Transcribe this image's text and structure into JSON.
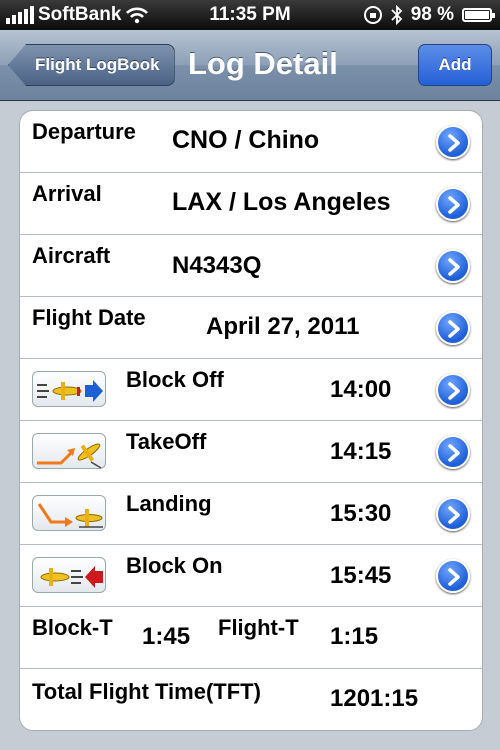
{
  "status_bar": {
    "carrier": "SoftBank",
    "time": "11:35 PM",
    "battery": "98 %",
    "battery_level": 0.98
  },
  "nav": {
    "back_label": "Flight LogBook",
    "title": "Log Detail",
    "add_label": "Add"
  },
  "rows": {
    "departure": {
      "label": "Departure",
      "value": "CNO / Chino"
    },
    "arrival": {
      "label": "Arrival",
      "value": "LAX / Los Angeles"
    },
    "aircraft": {
      "label": "Aircraft",
      "value": "N4343Q"
    },
    "flight_date": {
      "label": "Flight Date",
      "value": "April 27, 2011"
    },
    "block_off": {
      "label": "Block Off",
      "value": "14:00",
      "icon": "block-off-icon"
    },
    "takeoff": {
      "label": "TakeOff",
      "value": "14:15",
      "icon": "takeoff-icon"
    },
    "landing": {
      "label": "Landing",
      "value": "15:30",
      "icon": "landing-icon"
    },
    "block_on": {
      "label": "Block On",
      "value": "15:45",
      "icon": "block-on-icon"
    },
    "times": {
      "block_label": "Block-T",
      "block_value": "1:45",
      "flight_label": "Flight-T",
      "flight_value": "1:15"
    },
    "total": {
      "label": "Total Flight Time(TFT)",
      "value": "1201:15"
    }
  },
  "colors": {
    "accent": "#2460d6",
    "nav_bar": "#8da0b7",
    "background": "#c5ccd4",
    "arrow_blue": "#1e5fd8",
    "arrow_red": "#cc1a1a",
    "arrow_orange": "#f07a1a"
  }
}
